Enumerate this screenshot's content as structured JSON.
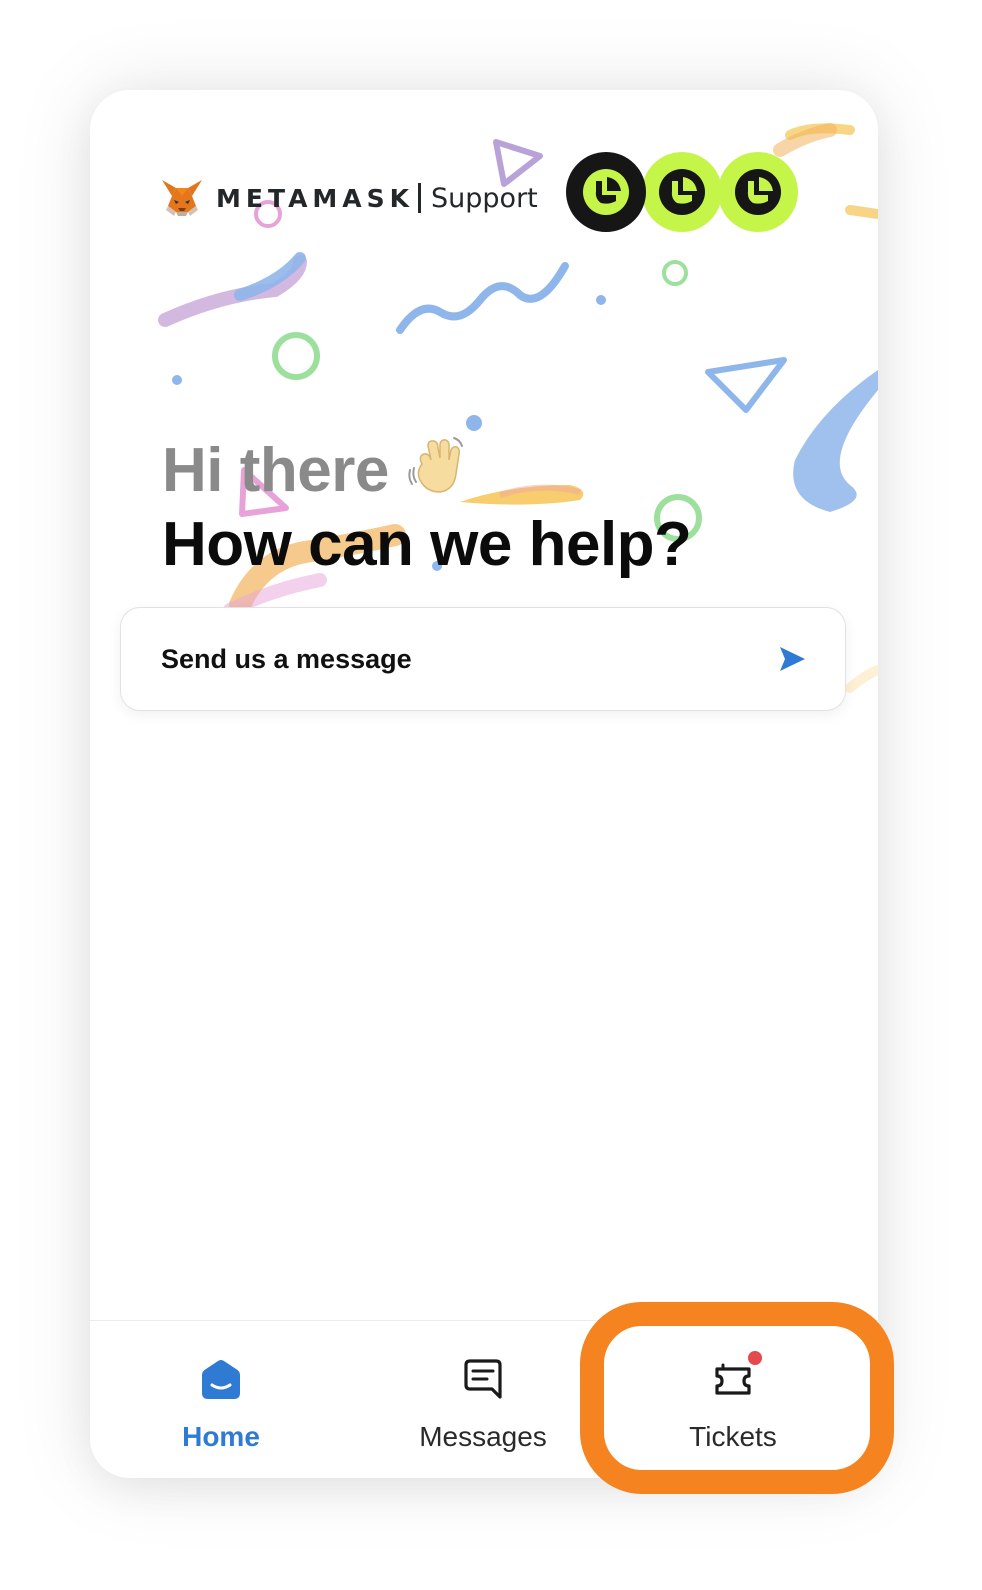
{
  "header": {
    "brand_name": "METAMASK",
    "brand_suffix": "Support",
    "team_avatars": [
      "avatar-1",
      "avatar-2",
      "avatar-3"
    ]
  },
  "hero": {
    "greeting": "Hi there",
    "greeting_emoji": "waving-hand",
    "headline": "How can we help?"
  },
  "actions": {
    "send_message_label": "Send us a message"
  },
  "nav": {
    "items": [
      {
        "label": "Home",
        "icon": "home-icon",
        "active": true
      },
      {
        "label": "Messages",
        "icon": "messages-icon",
        "active": false
      },
      {
        "label": "Tickets",
        "icon": "ticket-icon",
        "active": false,
        "has_notification": true
      }
    ]
  },
  "colors": {
    "accent_blue": "#2f7bd3",
    "avatar_dark": "#161616",
    "avatar_lime": "#c6f54a",
    "highlight_orange": "#f5831f",
    "notification_red": "#e5484d"
  }
}
